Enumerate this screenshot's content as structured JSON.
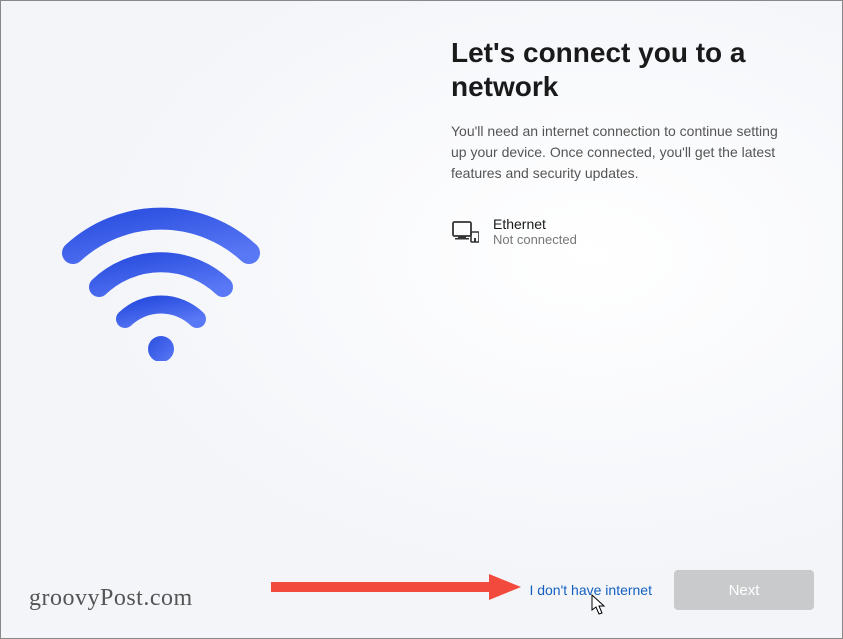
{
  "header": {
    "title": "Let's connect you to a network",
    "subtitle": "You'll need an internet connection to continue setting up your device. Once connected, you'll get the latest features and security updates."
  },
  "network": {
    "name": "Ethernet",
    "status": "Not connected"
  },
  "actions": {
    "no_internet_link": "I don't have internet",
    "next_label": "Next"
  },
  "watermark": "groovyPost.com",
  "colors": {
    "accent": "#3a57e8",
    "link": "#1560c0",
    "annotation": "#f24a3d"
  }
}
